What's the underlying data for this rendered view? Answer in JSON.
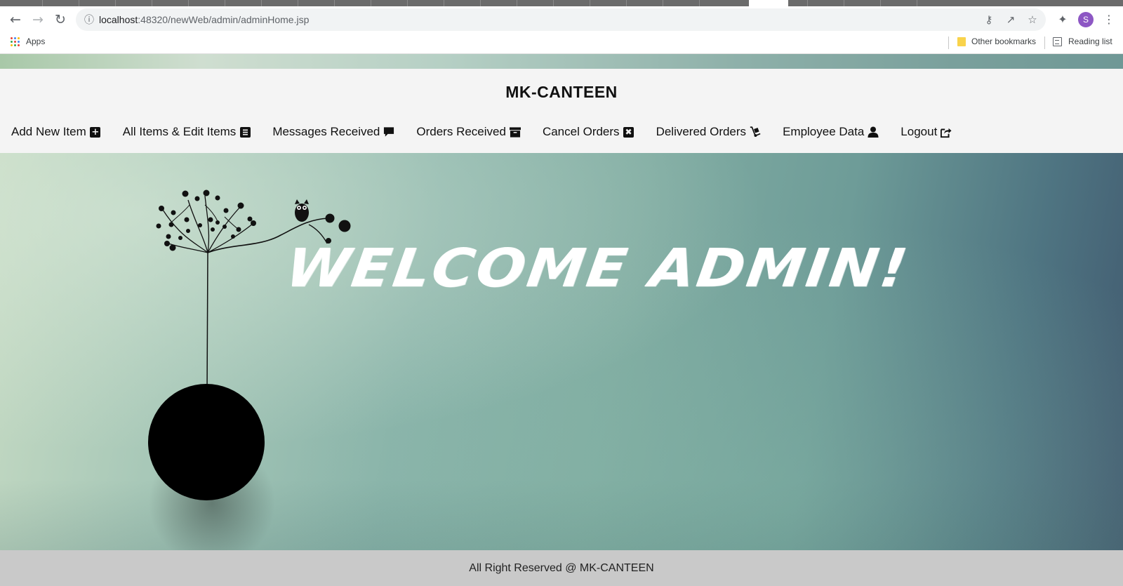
{
  "browser": {
    "url_host": "localhost",
    "url_port": ":48320",
    "url_path": "/newWeb/admin/adminHome.jsp",
    "profile_initial": "S",
    "bookmarks": {
      "apps_label": "Apps",
      "other_label": "Other bookmarks",
      "reading_label": "Reading list"
    }
  },
  "site": {
    "title": "MK-CANTEEN",
    "welcome": "WELCOME ADMIN!",
    "footer": "All Right Reserved @ MK-CANTEEN"
  },
  "nav": [
    {
      "label": "Add New Item",
      "icon": "plus-square-icon"
    },
    {
      "label": "All Items & Edit Items",
      "icon": "list-icon"
    },
    {
      "label": "Messages Received",
      "icon": "comment-icon"
    },
    {
      "label": "Orders Received",
      "icon": "archive-icon"
    },
    {
      "label": "Cancel Orders",
      "icon": "x-square-icon"
    },
    {
      "label": "Delivered Orders",
      "icon": "dolly-icon"
    },
    {
      "label": "Employee Data",
      "icon": "user-icon"
    },
    {
      "label": "Logout",
      "icon": "share-out-icon"
    }
  ],
  "colors": {
    "header_bg": "#f4f4f4",
    "footer_bg": "#c9c9c9",
    "profile": "#8d57c4"
  }
}
